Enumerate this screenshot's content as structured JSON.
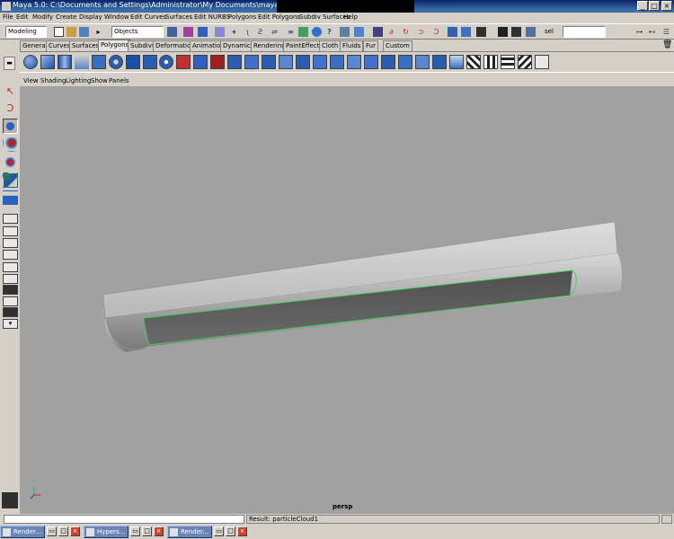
{
  "window": {
    "title": "Maya 5.0: C:\\Documents and Settings\\Administrator\\My Documents\\maya\\projects\\",
    "minimize_glyph": "_",
    "maximize_glyph": "□",
    "close_glyph": "×"
  },
  "menubar": [
    "File",
    "Edit",
    "Modify",
    "Create",
    "Display",
    "Window",
    "Edit Curves",
    "Surfaces",
    "Edit NURBS",
    "Polygons",
    "Edit Polygons",
    "Subdiv Surfaces",
    "Help"
  ],
  "statusline": {
    "menuset": "Modeling",
    "selection_mode": "Objects",
    "quick_select_label": "sel",
    "quick_select_value": ""
  },
  "shelf_tabs": [
    "General",
    "Curves",
    "Surfaces",
    "Polygons",
    "Subdivs",
    "Deformation",
    "Animation",
    "Dynamics",
    "Rendering",
    "PaintEffects",
    "Cloth",
    "Fluids",
    "Fur",
    "Custom"
  ],
  "shelf_active_tab": "Polygons",
  "panel_menu": [
    "View",
    "Shading",
    "Lighting",
    "Show",
    "Panels"
  ],
  "viewport": {
    "camera": "persp",
    "background": "#a1a1a1",
    "selection_color": "#3cd25a"
  },
  "commandline": {
    "value": "",
    "result": "Result: particleCloud1"
  },
  "taskbar": [
    {
      "label": "Render..."
    },
    {
      "label": "Hypers..."
    },
    {
      "label": "Render..."
    }
  ],
  "icons": {
    "shelf": [
      "poly-sphere-icon",
      "poly-cube-icon",
      "poly-cylinder-icon",
      "poly-cone-icon",
      "poly-plane-icon",
      "poly-torus-icon",
      "poly-pipe-icon",
      "poly-helix-icon",
      "poly-soccerball-icon",
      "create-polygon-icon",
      "append-polygon-icon",
      "split-polygon-icon",
      "cut-faces-icon",
      "extrude-face-icon",
      "extrude-edge-icon",
      "bevel-icon",
      "duplicate-face-icon",
      "extract-icon",
      "combine-icon",
      "separate-icon",
      "smooth-icon",
      "subdivide-icon",
      "merge-vertices-icon",
      "collapse-icon",
      "wedge-face-icon",
      "poke-face-icon",
      "planar-mapping-icon",
      "cylindrical-mapping-icon",
      "spherical-mapping-icon",
      "automatic-mapping-icon",
      "uv-editor-icon"
    ]
  }
}
